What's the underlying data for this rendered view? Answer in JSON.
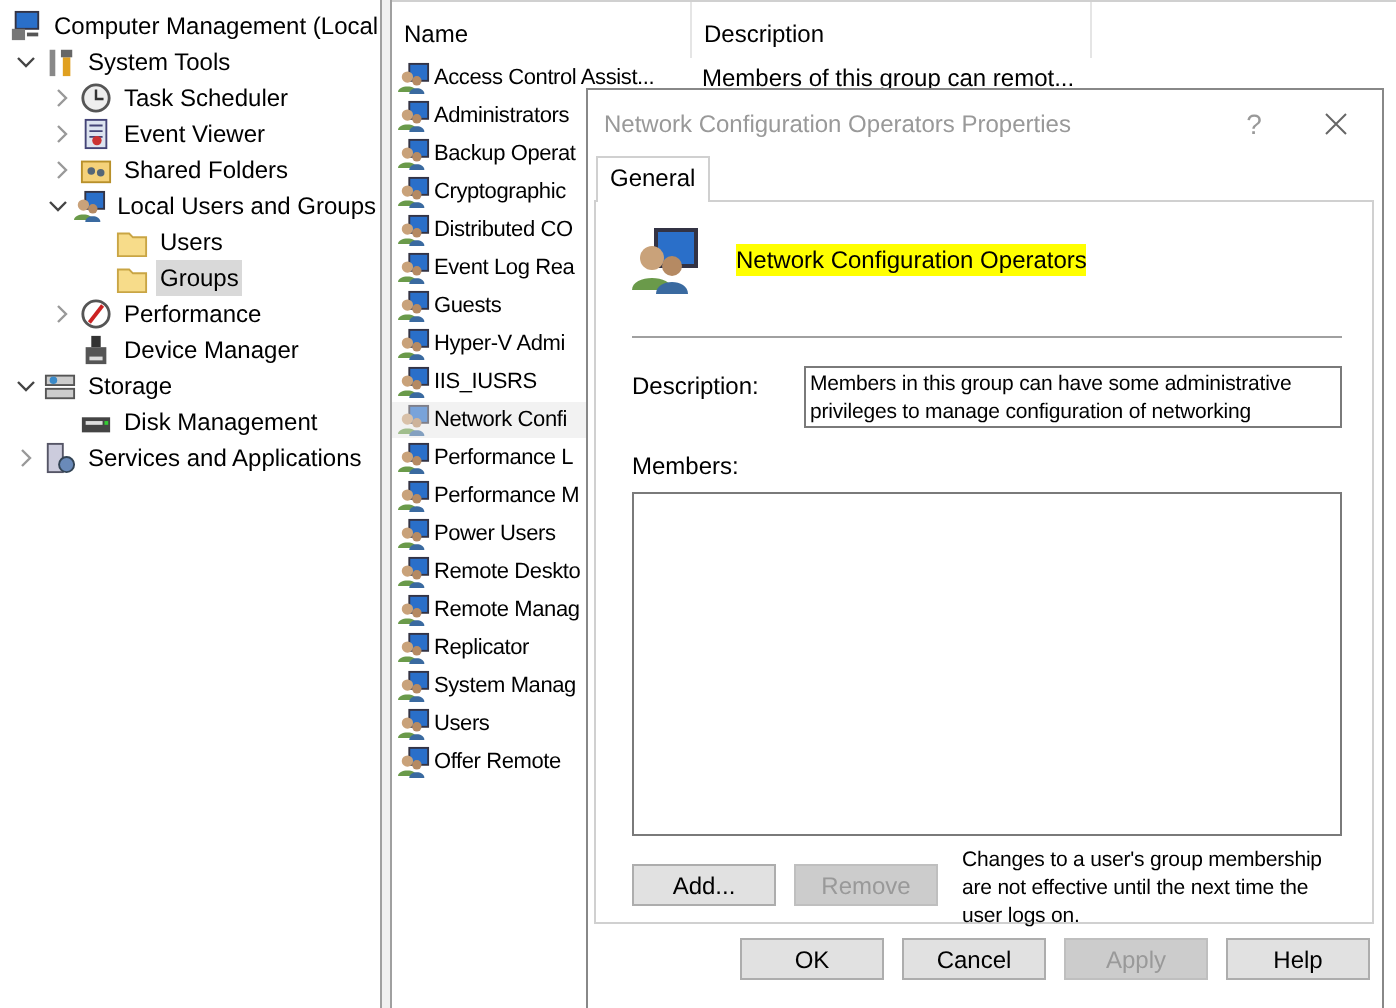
{
  "tree": [
    {
      "label": "Computer Management (Local",
      "kind": "computer",
      "selected": false,
      "children": [
        {
          "label": "System Tools",
          "kind": "tools",
          "expanded": true,
          "selected": false,
          "children": [
            {
              "label": "Task Scheduler",
              "kind": "clock",
              "expanded": false,
              "selected": false
            },
            {
              "label": "Event Viewer",
              "kind": "log",
              "expanded": false,
              "selected": false
            },
            {
              "label": "Shared Folders",
              "kind": "share",
              "expanded": false,
              "selected": false
            },
            {
              "label": "Local Users and Groups",
              "kind": "users",
              "expanded": true,
              "selected": false,
              "children": [
                {
                  "label": "Users",
                  "kind": "folder",
                  "selected": false
                },
                {
                  "label": "Groups",
                  "kind": "folder",
                  "selected": true
                }
              ]
            },
            {
              "label": "Performance",
              "kind": "performance",
              "expanded": false,
              "selected": false
            },
            {
              "label": "Device Manager",
              "kind": "device",
              "selected": false
            }
          ]
        },
        {
          "label": "Storage",
          "kind": "storage",
          "expanded": true,
          "selected": false,
          "children": [
            {
              "label": "Disk Management",
              "kind": "disk",
              "selected": false
            }
          ]
        },
        {
          "label": "Services and Applications",
          "kind": "services",
          "expanded": false,
          "selected": false
        }
      ]
    }
  ],
  "list": {
    "columns": [
      "Name",
      "Description"
    ],
    "rows": [
      {
        "name": "Access Control Assist...",
        "description": "Members of this group can remot...",
        "selected": false
      },
      {
        "name": "Administrators",
        "selected": false
      },
      {
        "name": "Backup Operat",
        "selected": false
      },
      {
        "name": "Cryptographic",
        "selected": false
      },
      {
        "name": "Distributed CO",
        "selected": false
      },
      {
        "name": "Event Log Rea",
        "selected": false
      },
      {
        "name": "Guests",
        "selected": false
      },
      {
        "name": "Hyper-V Admi",
        "selected": false
      },
      {
        "name": "IIS_IUSRS",
        "selected": false
      },
      {
        "name": "Network Confi",
        "selected": true
      },
      {
        "name": "Performance L",
        "selected": false
      },
      {
        "name": "Performance M",
        "selected": false
      },
      {
        "name": "Power Users",
        "selected": false
      },
      {
        "name": "Remote Deskto",
        "selected": false
      },
      {
        "name": "Remote Manag",
        "selected": false
      },
      {
        "name": "Replicator",
        "selected": false
      },
      {
        "name": "System Manag",
        "selected": false
      },
      {
        "name": "Users",
        "selected": false
      },
      {
        "name": "Offer Remote",
        "selected": false
      }
    ]
  },
  "dialog": {
    "title": "Network Configuration Operators Properties",
    "help": "?",
    "tabs": [
      {
        "label": "General",
        "selected": true
      }
    ],
    "group_name": {
      "text": "Network Configuration Operators",
      "highlighted": true
    },
    "description_label": "Description:",
    "description": "Members in this group can have some administrative privileges to manage configuration of networking",
    "members_label": "Members:",
    "member_buttons": [
      {
        "label": "Add...",
        "disabled": false
      },
      {
        "label": "Remove",
        "disabled": true
      }
    ],
    "note": "Changes to a user's group membership are not effective until the next time the user logs on.",
    "buttons": [
      {
        "label": "OK",
        "disabled": false
      },
      {
        "label": "Cancel",
        "disabled": false
      },
      {
        "label": "Apply",
        "disabled": true
      },
      {
        "label": "Help",
        "disabled": false
      }
    ]
  }
}
